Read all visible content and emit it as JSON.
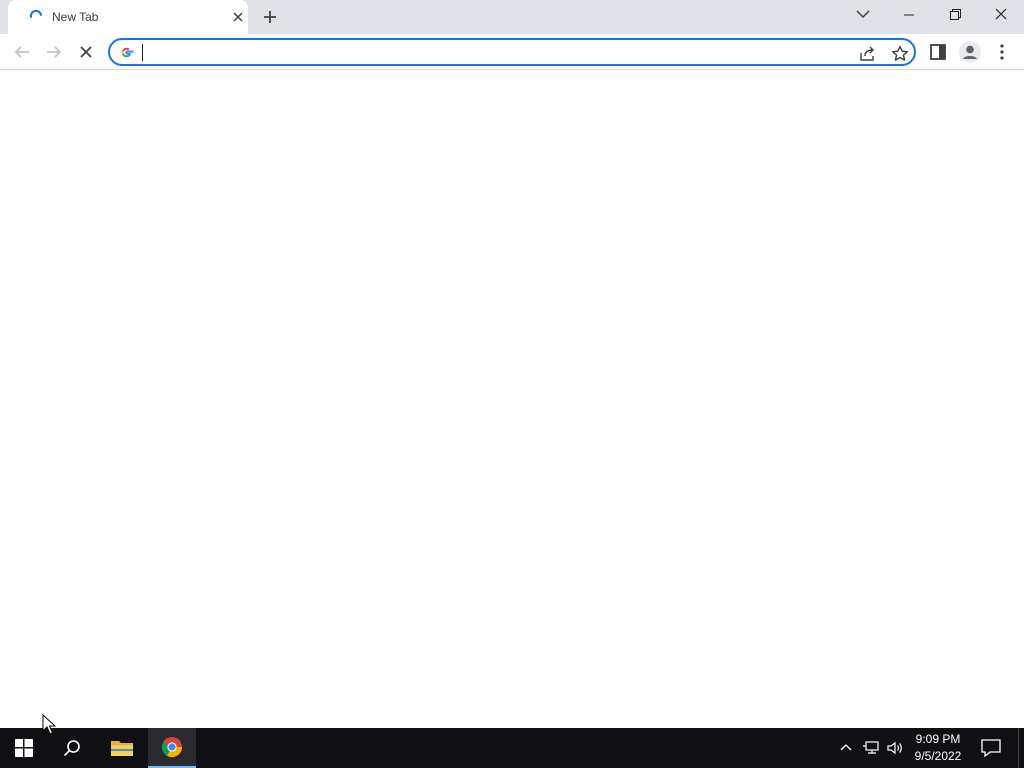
{
  "tab": {
    "title": "New Tab"
  },
  "omnibox": {
    "value": "",
    "placeholder": ""
  },
  "taskbar": {
    "clock": {
      "time": "9:09 PM",
      "date": "9/5/2022"
    }
  },
  "colors": {
    "accent": "#1a73e8",
    "tab_strip": "#dee1e6",
    "taskbar": "#101014"
  },
  "icons": {
    "tab": [
      "loading-spinner-icon",
      "close-icon",
      "plus-icon",
      "chevron-down-icon",
      "minimize-icon",
      "restore-icon",
      "close-window-icon"
    ],
    "toolbar": [
      "back-arrow-icon",
      "forward-arrow-icon",
      "stop-icon",
      "google-g-icon",
      "share-icon",
      "star-icon",
      "side-panel-icon",
      "profile-icon",
      "kebab-menu-icon"
    ],
    "taskbar": [
      "windows-start-icon",
      "search-icon",
      "file-explorer-icon",
      "chrome-icon",
      "chevron-up-icon",
      "network-icon",
      "volume-icon",
      "notification-icon"
    ]
  }
}
